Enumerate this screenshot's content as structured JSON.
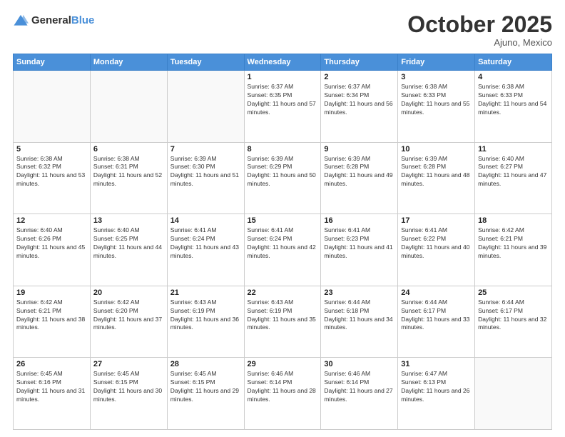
{
  "header": {
    "logo_general": "General",
    "logo_blue": "Blue",
    "month": "October 2025",
    "location": "Ajuno, Mexico"
  },
  "days_of_week": [
    "Sunday",
    "Monday",
    "Tuesday",
    "Wednesday",
    "Thursday",
    "Friday",
    "Saturday"
  ],
  "weeks": [
    [
      {
        "day": "",
        "sunrise": "",
        "sunset": "",
        "daylight": ""
      },
      {
        "day": "",
        "sunrise": "",
        "sunset": "",
        "daylight": ""
      },
      {
        "day": "",
        "sunrise": "",
        "sunset": "",
        "daylight": ""
      },
      {
        "day": "1",
        "sunrise": "Sunrise: 6:37 AM",
        "sunset": "Sunset: 6:35 PM",
        "daylight": "Daylight: 11 hours and 57 minutes."
      },
      {
        "day": "2",
        "sunrise": "Sunrise: 6:37 AM",
        "sunset": "Sunset: 6:34 PM",
        "daylight": "Daylight: 11 hours and 56 minutes."
      },
      {
        "day": "3",
        "sunrise": "Sunrise: 6:38 AM",
        "sunset": "Sunset: 6:33 PM",
        "daylight": "Daylight: 11 hours and 55 minutes."
      },
      {
        "day": "4",
        "sunrise": "Sunrise: 6:38 AM",
        "sunset": "Sunset: 6:33 PM",
        "daylight": "Daylight: 11 hours and 54 minutes."
      }
    ],
    [
      {
        "day": "5",
        "sunrise": "Sunrise: 6:38 AM",
        "sunset": "Sunset: 6:32 PM",
        "daylight": "Daylight: 11 hours and 53 minutes."
      },
      {
        "day": "6",
        "sunrise": "Sunrise: 6:38 AM",
        "sunset": "Sunset: 6:31 PM",
        "daylight": "Daylight: 11 hours and 52 minutes."
      },
      {
        "day": "7",
        "sunrise": "Sunrise: 6:39 AM",
        "sunset": "Sunset: 6:30 PM",
        "daylight": "Daylight: 11 hours and 51 minutes."
      },
      {
        "day": "8",
        "sunrise": "Sunrise: 6:39 AM",
        "sunset": "Sunset: 6:29 PM",
        "daylight": "Daylight: 11 hours and 50 minutes."
      },
      {
        "day": "9",
        "sunrise": "Sunrise: 6:39 AM",
        "sunset": "Sunset: 6:28 PM",
        "daylight": "Daylight: 11 hours and 49 minutes."
      },
      {
        "day": "10",
        "sunrise": "Sunrise: 6:39 AM",
        "sunset": "Sunset: 6:28 PM",
        "daylight": "Daylight: 11 hours and 48 minutes."
      },
      {
        "day": "11",
        "sunrise": "Sunrise: 6:40 AM",
        "sunset": "Sunset: 6:27 PM",
        "daylight": "Daylight: 11 hours and 47 minutes."
      }
    ],
    [
      {
        "day": "12",
        "sunrise": "Sunrise: 6:40 AM",
        "sunset": "Sunset: 6:26 PM",
        "daylight": "Daylight: 11 hours and 45 minutes."
      },
      {
        "day": "13",
        "sunrise": "Sunrise: 6:40 AM",
        "sunset": "Sunset: 6:25 PM",
        "daylight": "Daylight: 11 hours and 44 minutes."
      },
      {
        "day": "14",
        "sunrise": "Sunrise: 6:41 AM",
        "sunset": "Sunset: 6:24 PM",
        "daylight": "Daylight: 11 hours and 43 minutes."
      },
      {
        "day": "15",
        "sunrise": "Sunrise: 6:41 AM",
        "sunset": "Sunset: 6:24 PM",
        "daylight": "Daylight: 11 hours and 42 minutes."
      },
      {
        "day": "16",
        "sunrise": "Sunrise: 6:41 AM",
        "sunset": "Sunset: 6:23 PM",
        "daylight": "Daylight: 11 hours and 41 minutes."
      },
      {
        "day": "17",
        "sunrise": "Sunrise: 6:41 AM",
        "sunset": "Sunset: 6:22 PM",
        "daylight": "Daylight: 11 hours and 40 minutes."
      },
      {
        "day": "18",
        "sunrise": "Sunrise: 6:42 AM",
        "sunset": "Sunset: 6:21 PM",
        "daylight": "Daylight: 11 hours and 39 minutes."
      }
    ],
    [
      {
        "day": "19",
        "sunrise": "Sunrise: 6:42 AM",
        "sunset": "Sunset: 6:21 PM",
        "daylight": "Daylight: 11 hours and 38 minutes."
      },
      {
        "day": "20",
        "sunrise": "Sunrise: 6:42 AM",
        "sunset": "Sunset: 6:20 PM",
        "daylight": "Daylight: 11 hours and 37 minutes."
      },
      {
        "day": "21",
        "sunrise": "Sunrise: 6:43 AM",
        "sunset": "Sunset: 6:19 PM",
        "daylight": "Daylight: 11 hours and 36 minutes."
      },
      {
        "day": "22",
        "sunrise": "Sunrise: 6:43 AM",
        "sunset": "Sunset: 6:19 PM",
        "daylight": "Daylight: 11 hours and 35 minutes."
      },
      {
        "day": "23",
        "sunrise": "Sunrise: 6:44 AM",
        "sunset": "Sunset: 6:18 PM",
        "daylight": "Daylight: 11 hours and 34 minutes."
      },
      {
        "day": "24",
        "sunrise": "Sunrise: 6:44 AM",
        "sunset": "Sunset: 6:17 PM",
        "daylight": "Daylight: 11 hours and 33 minutes."
      },
      {
        "day": "25",
        "sunrise": "Sunrise: 6:44 AM",
        "sunset": "Sunset: 6:17 PM",
        "daylight": "Daylight: 11 hours and 32 minutes."
      }
    ],
    [
      {
        "day": "26",
        "sunrise": "Sunrise: 6:45 AM",
        "sunset": "Sunset: 6:16 PM",
        "daylight": "Daylight: 11 hours and 31 minutes."
      },
      {
        "day": "27",
        "sunrise": "Sunrise: 6:45 AM",
        "sunset": "Sunset: 6:15 PM",
        "daylight": "Daylight: 11 hours and 30 minutes."
      },
      {
        "day": "28",
        "sunrise": "Sunrise: 6:45 AM",
        "sunset": "Sunset: 6:15 PM",
        "daylight": "Daylight: 11 hours and 29 minutes."
      },
      {
        "day": "29",
        "sunrise": "Sunrise: 6:46 AM",
        "sunset": "Sunset: 6:14 PM",
        "daylight": "Daylight: 11 hours and 28 minutes."
      },
      {
        "day": "30",
        "sunrise": "Sunrise: 6:46 AM",
        "sunset": "Sunset: 6:14 PM",
        "daylight": "Daylight: 11 hours and 27 minutes."
      },
      {
        "day": "31",
        "sunrise": "Sunrise: 6:47 AM",
        "sunset": "Sunset: 6:13 PM",
        "daylight": "Daylight: 11 hours and 26 minutes."
      },
      {
        "day": "",
        "sunrise": "",
        "sunset": "",
        "daylight": ""
      }
    ]
  ]
}
